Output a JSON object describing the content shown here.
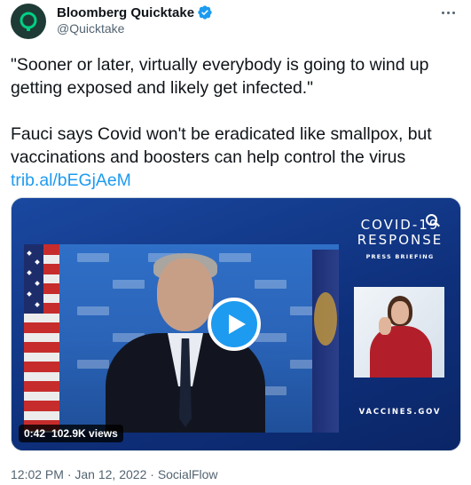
{
  "author": {
    "display_name": "Bloomberg Quicktake",
    "handle": "@Quicktake",
    "verified": true,
    "avatar_color": "#1e3b35",
    "avatar_accent": "#00d084"
  },
  "tweet": {
    "line1": "\"Sooner or later, virtually everybody is going to wind up",
    "line2": "getting exposed and likely get infected.\"",
    "line3": "Fauci says Covid won't be eradicated like smallpox, but",
    "line4": "vaccinations and boosters can help control the virus",
    "link": "trib.al/bEGjAeM"
  },
  "media": {
    "overlay_title_1": "COVID-19",
    "overlay_title_2": "RESPONSE",
    "overlay_subtitle": "PRESS BRIEFING",
    "overlay_footer": "VACCINES.GOV",
    "duration": "0:42",
    "views": "102.9K views",
    "play_color": "#1d9bf0"
  },
  "footer": {
    "time": "12:02 PM",
    "separator": "·",
    "date": "Jan 12, 2022",
    "source": "SocialFlow"
  },
  "colors": {
    "link": "#1d9bf0",
    "secondary_text": "#536471",
    "primary_text": "#0f1419"
  },
  "icons": {
    "verified": "verified-badge-icon",
    "more": "more-options-icon",
    "play": "play-icon"
  }
}
